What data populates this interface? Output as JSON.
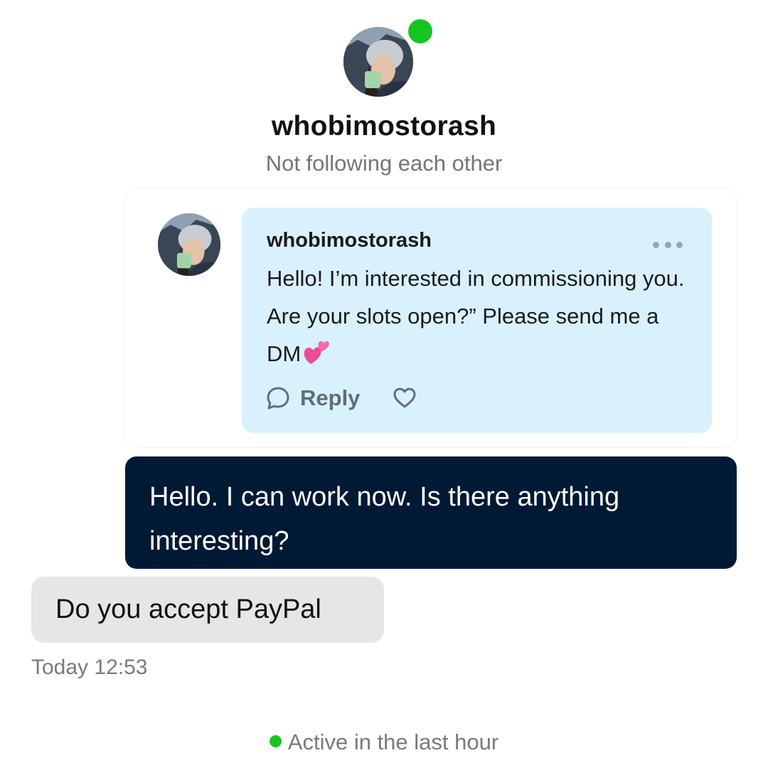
{
  "header": {
    "username": "whobimostorash",
    "follow_status": "Not following each other",
    "online_color": "#17c41f"
  },
  "shared_post": {
    "author": "whobimostorash",
    "text": "Hello! I’m interested in commissioning you. Are your slots open?” Please send me a DM",
    "emoji": "two-hearts-emoji",
    "reply_label": "Reply",
    "icons": [
      "comment-icon",
      "heart-icon",
      "more-options-icon"
    ],
    "background": "#d9f1fc"
  },
  "messages": [
    {
      "direction": "outgoing",
      "text": "Hello. I can work now. Is there anything interesting?"
    },
    {
      "direction": "incoming",
      "text": "Do you accept PayPal"
    }
  ],
  "timestamp": "Today 12:53",
  "presence": "Active in the last hour"
}
